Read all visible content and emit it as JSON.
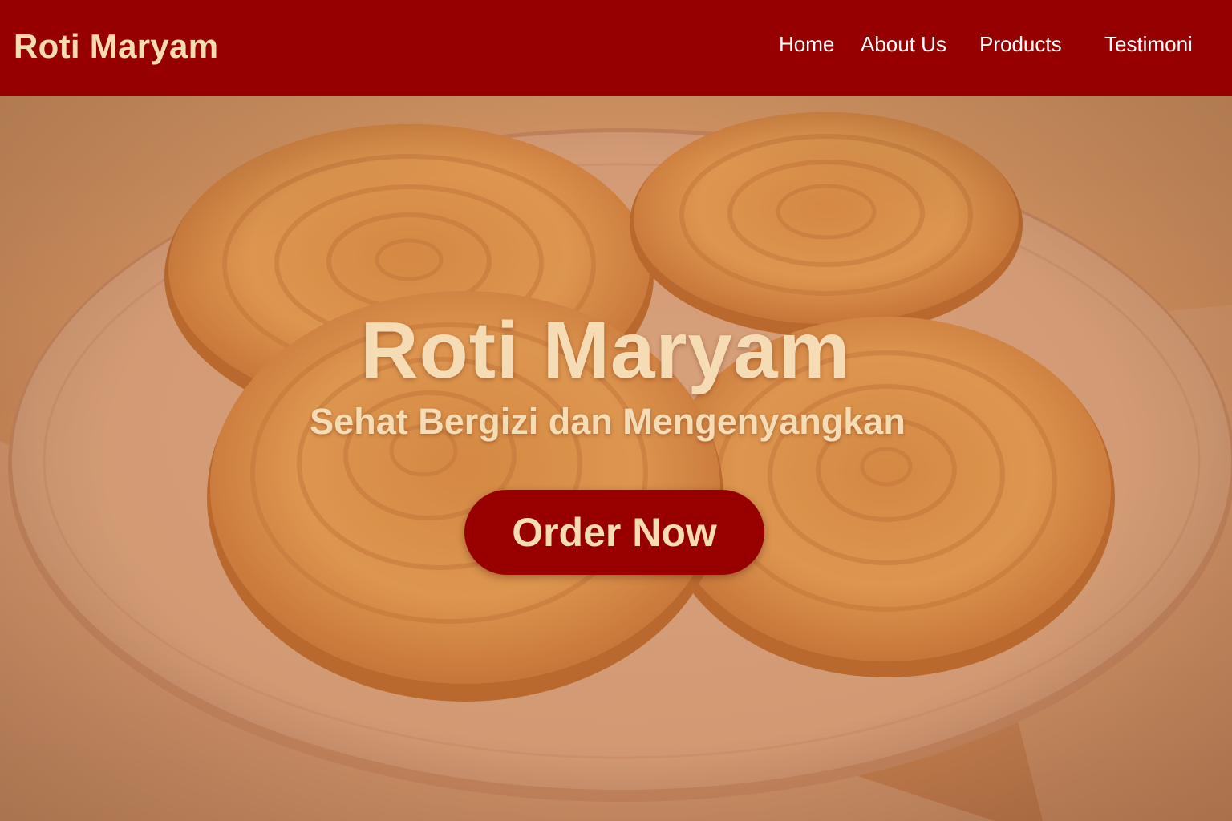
{
  "navbar": {
    "brand": "Roti Maryam",
    "links": [
      {
        "label": "Home"
      },
      {
        "label": "About Us"
      },
      {
        "label": "Products"
      },
      {
        "label": "Testimoni"
      }
    ]
  },
  "hero": {
    "title": "Roti Maryam",
    "subtitle": "Sehat Bergizi dan Mengenyangkan",
    "cta_label": "Order Now"
  },
  "colors": {
    "brand_red": "#960000",
    "cream_text": "#f6dcb4",
    "nav_text": "#ffffff"
  }
}
